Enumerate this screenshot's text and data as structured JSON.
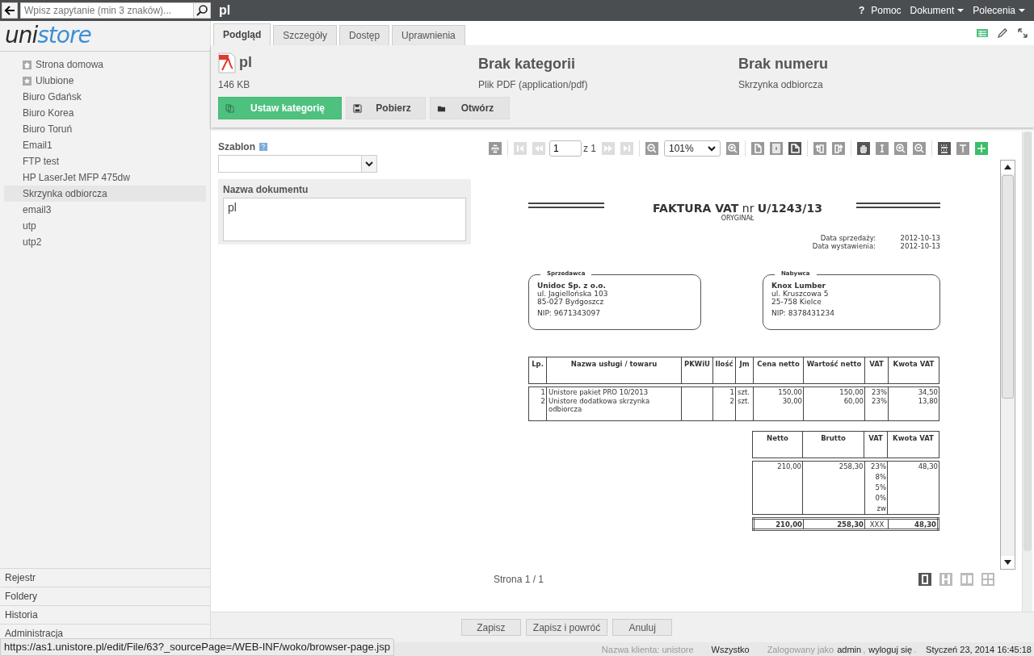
{
  "search": {
    "placeholder": "Wpisz zapytanie (min 3 znaków)..."
  },
  "title": "pl",
  "top_menu": [
    {
      "label": "Pomoc",
      "kind": "help",
      "glyph": "?"
    },
    {
      "label": "Dokument",
      "kind": "dropdown"
    },
    {
      "label": "Polecenia",
      "kind": "dropdown"
    }
  ],
  "logo": {
    "dark": "uni",
    "accent": "store"
  },
  "sidebar": {
    "items": [
      {
        "label": "Strona domowa",
        "kind": "home",
        "selected": false
      },
      {
        "label": "Ulubione",
        "kind": "star",
        "selected": false
      },
      {
        "label": "Biuro Gdańsk",
        "kind": "plain",
        "selected": false
      },
      {
        "label": "Biuro Korea",
        "kind": "plain",
        "selected": false
      },
      {
        "label": "Biuro Toruń",
        "kind": "plain",
        "selected": false
      },
      {
        "label": "Email1",
        "kind": "plain",
        "selected": false
      },
      {
        "label": "FTP test",
        "kind": "plain",
        "selected": false
      },
      {
        "label": "HP LaserJet MFP 475dw",
        "kind": "plain",
        "selected": false
      },
      {
        "label": "Skrzynka odbiorcza",
        "kind": "plain",
        "selected": true
      },
      {
        "label": "email3",
        "kind": "plain",
        "selected": false
      },
      {
        "label": "utp",
        "kind": "plain",
        "selected": false
      },
      {
        "label": "utp2",
        "kind": "plain",
        "selected": false
      }
    ],
    "sections": [
      "Rejestr",
      "Foldery",
      "Historia",
      "Administracja"
    ]
  },
  "tabs": [
    {
      "label": "Podgląd",
      "selected": true
    },
    {
      "label": "Szczegóły",
      "selected": false
    },
    {
      "label": "Dostęp",
      "selected": false
    },
    {
      "label": "Uprawnienia",
      "selected": false
    }
  ],
  "document": {
    "name": "pl",
    "size": "146 KB",
    "category": "Brak kategorii",
    "type": "Plik PDF (application/pdf)",
    "number": "Brak numeru",
    "location": "Skrzynka odbiorcza"
  },
  "actions": [
    {
      "label": "Ustaw kategorię",
      "kind": "category",
      "primary": true
    },
    {
      "label": "Pobierz",
      "kind": "save",
      "primary": false
    },
    {
      "label": "Otwórz",
      "kind": "open",
      "primary": false
    }
  ],
  "form": {
    "template_label": "Szablon",
    "name_label": "Nazwa dokumentu",
    "name_value": "pl"
  },
  "viewer": {
    "page_input": "1",
    "page_of": "z 1",
    "zoom": "101%",
    "page_status": "Strona 1 / 1",
    "nav_back": [
      {
        "kind": "first",
        "disabled": true
      },
      {
        "kind": "prev",
        "disabled": true
      }
    ],
    "nav_forward": [
      {
        "kind": "next",
        "disabled": true
      },
      {
        "kind": "last",
        "disabled": true
      }
    ],
    "tool_groups": [
      [
        {
          "kind": "fit-page",
          "selected": false
        },
        {
          "kind": "fit-width",
          "selected": false
        },
        {
          "kind": "fold",
          "selected": true
        }
      ],
      [
        {
          "kind": "rotate-left",
          "selected": false
        },
        {
          "kind": "rotate-right",
          "selected": false
        }
      ],
      [
        {
          "kind": "hand",
          "selected": true
        },
        {
          "kind": "text",
          "selected": false
        },
        {
          "kind": "zoom-in",
          "selected": false
        },
        {
          "kind": "zoom-out",
          "selected": false
        }
      ],
      [
        {
          "kind": "grid",
          "selected": true
        },
        {
          "kind": "type",
          "selected": false
        },
        {
          "kind": "add",
          "selected": false
        }
      ]
    ],
    "view_modes": [
      {
        "kind": "single",
        "selected": true
      },
      {
        "kind": "continuous",
        "selected": false
      },
      {
        "kind": "double",
        "selected": false
      },
      {
        "kind": "thumbs",
        "selected": false
      }
    ]
  },
  "invoice": {
    "title": "FAKTURA VAT",
    "nr": "nr",
    "number": "U/1243/13",
    "copy": "ORYGINAŁ",
    "dates": [
      {
        "label": "Data sprzedaży:",
        "value": "2012-10-13"
      },
      {
        "label": "Data wystawienia:",
        "value": "2012-10-13"
      }
    ],
    "parties": [
      {
        "heading": "Sprzedawca",
        "name": "Unidoc Sp. z o.o.",
        "lines": [
          "ul. Jagiellońska 103",
          "85-027 Bydgoszcz"
        ],
        "nip": "NIP: 9671343097"
      },
      {
        "heading": "Nabywca",
        "name": "Knox Lumber",
        "lines": [
          "ul. Kruszcowa 5",
          "25-758 Kielce"
        ],
        "nip": "NIP: 8378431234"
      }
    ],
    "items": {
      "columns": [
        "Lp.",
        "Nazwa usługi / towaru",
        "PKWiU",
        "Ilość",
        "Jm",
        "Cena netto",
        "Wartość netto",
        "VAT",
        "Kwota VAT"
      ],
      "rows": [
        {
          "lp": "1",
          "name": "Unistore pakiet PRO 10/2013",
          "qty": "1",
          "unit": "szt.",
          "price": "150,00",
          "value": "150,00",
          "vat": "23%",
          "vat_amount": "34,50"
        },
        {
          "lp": "2",
          "name": "Unistore dodatkowa skrzynka odbiorcza",
          "qty": "2",
          "unit": "szt.",
          "price": "30,00",
          "value": "60,00",
          "vat": "23%",
          "vat_amount": "13,80"
        }
      ]
    },
    "summary": {
      "columns": [
        "Netto",
        "Brutto",
        "VAT",
        "Kwota VAT"
      ],
      "row": [
        "210,00",
        "258,30",
        "23%",
        "48,30"
      ],
      "other_rates": [
        "8%",
        "5%",
        "0%",
        "zw"
      ],
      "total": [
        "210,00",
        "258,30",
        "XXX",
        "48,30"
      ]
    }
  },
  "form_buttons": [
    "Zapisz",
    "Zapisz i powróć",
    "Anuluj"
  ],
  "status_bar": {
    "url": "https://as1.unistore.pl/edit/File/63?_sourcePage=/WEB-INF/woko/browser-page.jsp",
    "client": "Nazwa klienta: unistore",
    "scope": "Wszystko",
    "logged_as": "Zalogowany jako",
    "user": "admin",
    "comma": ",",
    "logout": "wyloguj się",
    "period": ".",
    "datetime": "Styczeń 23, 2014 16:45:18"
  }
}
